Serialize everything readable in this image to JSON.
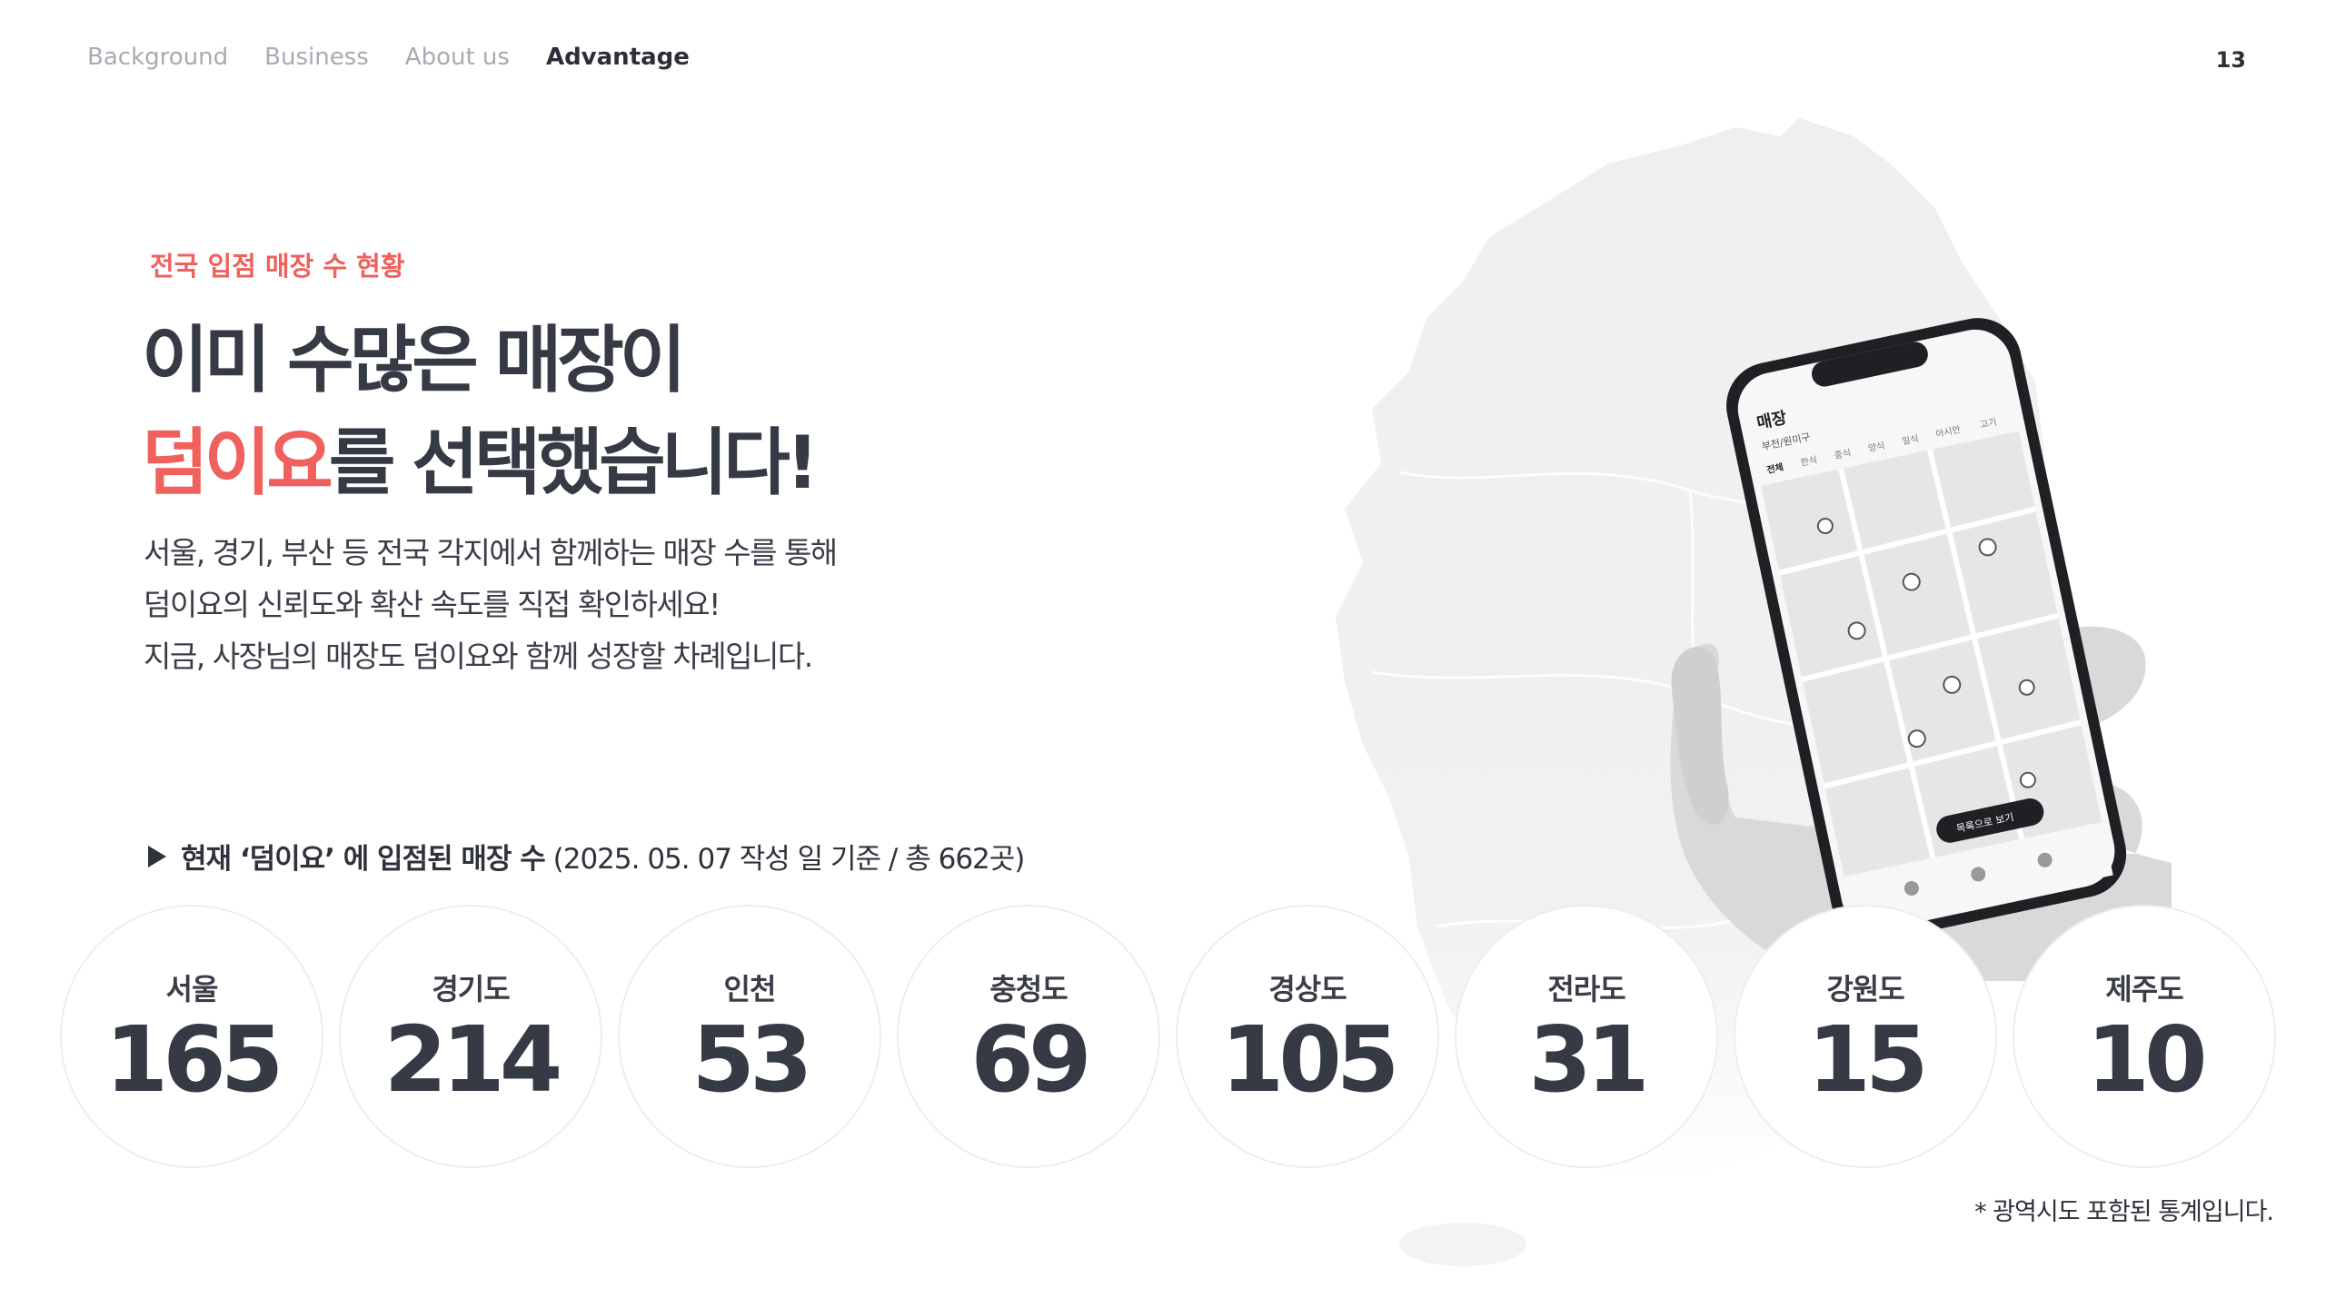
{
  "nav": {
    "items": [
      {
        "label": "Background",
        "active": false
      },
      {
        "label": "Business",
        "active": false
      },
      {
        "label": "About us",
        "active": false
      },
      {
        "label": "Advantage",
        "active": true
      }
    ],
    "page_number": "13"
  },
  "hero": {
    "eyebrow": "전국 입점 매장 수 현황",
    "headline_line1": "이미 수많은 매장이",
    "headline_accent": "덤이요",
    "headline_line2_rest": "를 선택했습니다!",
    "description": [
      "서울, 경기, 부산 등 전국 각지에서 함께하는 매장 수를 통해",
      "덤이요의 신뢰도와 확산 속도를 직접 확인하세요!",
      "지금, 사장님의 매장도 덤이요와 함께 성장할 차례입니다."
    ]
  },
  "caption": {
    "bold": "현재 ‘덤이요’ 에 입점된 매장 수",
    "note": "(2025. 05. 07 작성 일 기준 / 총 662곳)"
  },
  "phone": {
    "screen_title": "매장",
    "location": "부천/원미구",
    "categories": [
      "전체",
      "한식",
      "중식",
      "양식",
      "일식",
      "아시안",
      "고기"
    ],
    "list_button": "목록으로 보기"
  },
  "stats": [
    {
      "region": "서울",
      "count": "165"
    },
    {
      "region": "경기도",
      "count": "214"
    },
    {
      "region": "인천",
      "count": "53"
    },
    {
      "region": "충청도",
      "count": "69"
    },
    {
      "region": "경상도",
      "count": "105"
    },
    {
      "region": "전라도",
      "count": "31"
    },
    {
      "region": "강원도",
      "count": "15"
    },
    {
      "region": "제주도",
      "count": "10"
    }
  ],
  "footnote": "* 광역시도 포함된 통계입니다.",
  "colors": {
    "accent": "#f0605c",
    "text_dark": "#363a45",
    "nav_muted": "#a8abb2"
  }
}
